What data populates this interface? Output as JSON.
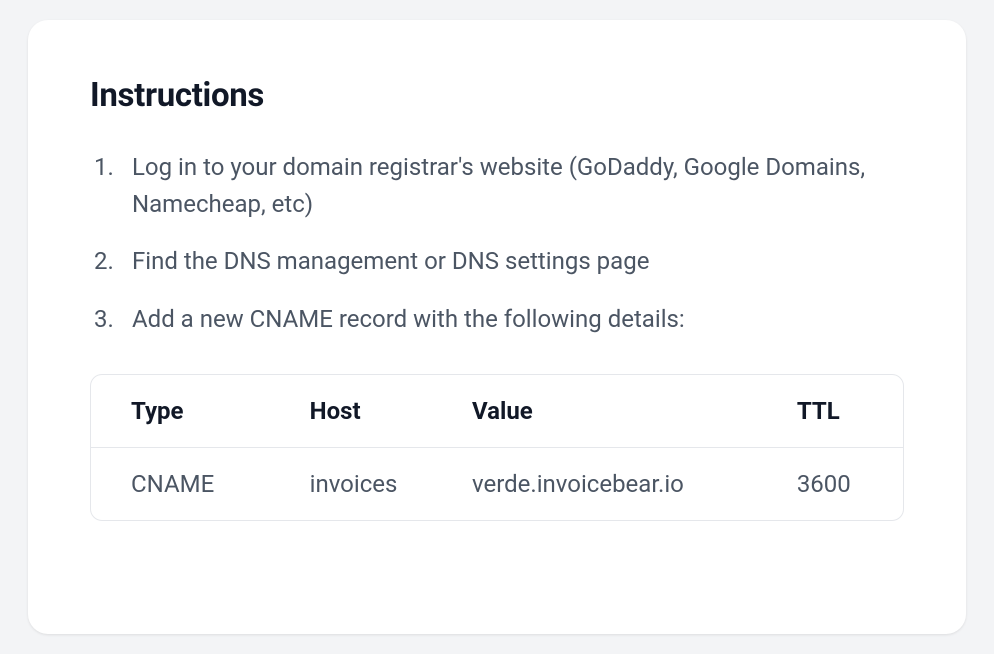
{
  "title": "Instructions",
  "steps": [
    "Log in to your domain registrar's website (GoDaddy, Google Domains, Namecheap, etc)",
    "Find the DNS management or DNS settings page",
    "Add a new CNAME record with the following details:"
  ],
  "dns": {
    "headers": {
      "type": "Type",
      "host": "Host",
      "value": "Value",
      "ttl": "TTL"
    },
    "record": {
      "type": "CNAME",
      "host": "invoices",
      "value": "verde.invoicebear.io",
      "ttl": "3600"
    }
  }
}
